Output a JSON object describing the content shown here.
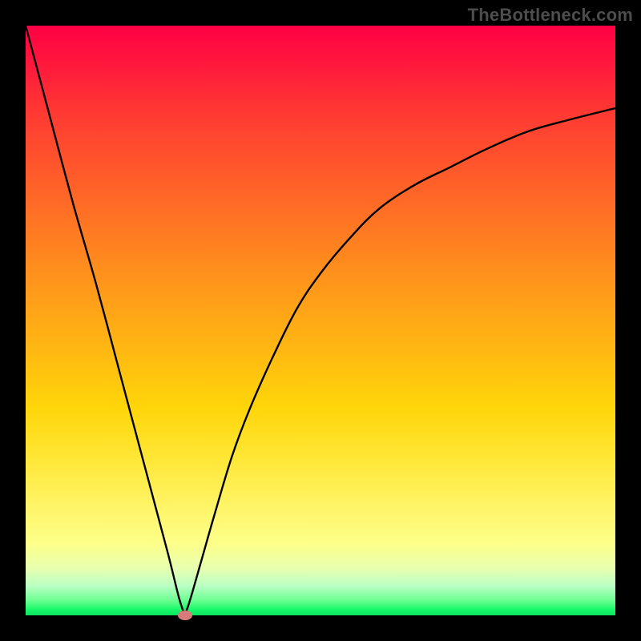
{
  "watermark": "TheBottleneck.com",
  "colors": {
    "frame": "#000000",
    "curve": "#000000",
    "dot": "#d97a7a"
  },
  "chart_data": {
    "type": "line",
    "title": "",
    "xlabel": "",
    "ylabel": "",
    "xlim": [
      0,
      100
    ],
    "ylim": [
      0,
      100
    ],
    "grid": false,
    "legend": false,
    "note": "Values read off the axes-less plot by position; x and y are percent of plot width/height measured from lower-left.",
    "series": [
      {
        "name": "left-branch",
        "x": [
          0,
          4,
          8,
          12,
          16,
          20,
          24,
          26,
          27
        ],
        "y": [
          100,
          85,
          70,
          56,
          41,
          26,
          11,
          3,
          0
        ]
      },
      {
        "name": "right-branch",
        "x": [
          27,
          28,
          30,
          32,
          35,
          38,
          42,
          46,
          50,
          55,
          60,
          66,
          72,
          78,
          85,
          92,
          100
        ],
        "y": [
          0,
          3,
          10,
          17,
          27,
          35,
          44,
          52,
          58,
          64,
          69,
          73,
          76,
          79,
          82,
          84,
          86
        ]
      }
    ],
    "marker": {
      "x": 27,
      "y": 0
    },
    "background_gradient_meaning": "red-high to green-low (vertical)"
  }
}
